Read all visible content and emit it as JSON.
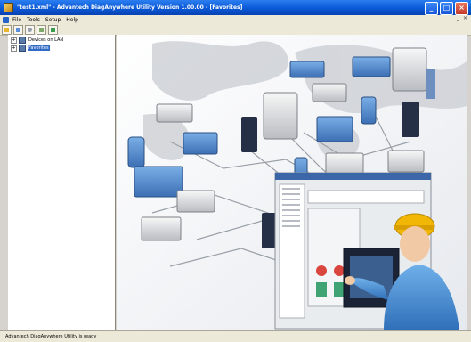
{
  "window": {
    "title": "\"test1.xml\" - Advantech DiagAnywhere Utility Version 1.00.00 - [Favorites]",
    "minimize_glyph": "_",
    "maximize_glyph": "□",
    "close_glyph": "×"
  },
  "menu": {
    "items": [
      "File",
      "Tools",
      "Setup",
      "Help"
    ],
    "mdi_controls": [
      "_",
      "×"
    ]
  },
  "toolbar": {
    "buttons": [
      "open-icon",
      "connect-icon",
      "search-icon",
      "refresh-icon",
      "exit-icon"
    ]
  },
  "tree": {
    "items": [
      {
        "label": "Devices on LAN",
        "expander": "+",
        "selected": false
      },
      {
        "label": "Favorites",
        "expander": "+",
        "selected": true
      }
    ]
  },
  "status": {
    "text": "Advantech DiagAnywhere Utility is ready"
  },
  "colors": {
    "titlebar": "#0a58d6",
    "selection": "#316ac5",
    "helmet": "#f2b705",
    "device_blue": "#4a7fc0",
    "device_green": "#3fa373"
  }
}
